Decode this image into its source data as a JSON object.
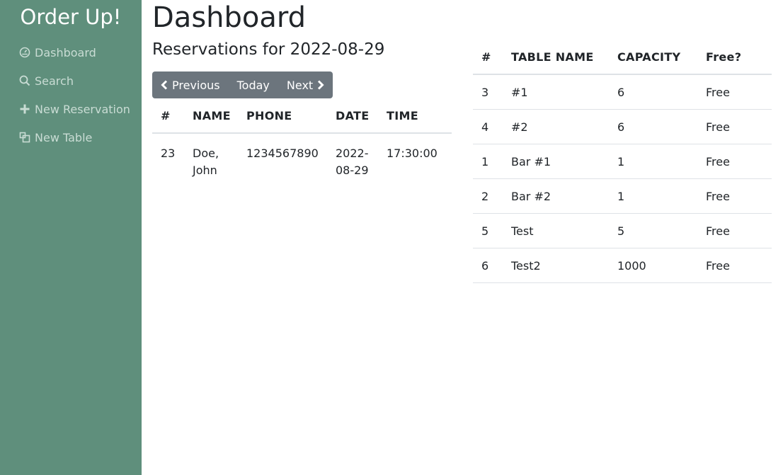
{
  "brand": "Order Up!",
  "nav": [
    {
      "label": "Dashboard",
      "icon": "dashboard-icon"
    },
    {
      "label": "Search",
      "icon": "search-icon"
    },
    {
      "label": "New Reservation",
      "icon": "plus-icon"
    },
    {
      "label": "New Table",
      "icon": "table-icon"
    }
  ],
  "page": {
    "title": "Dashboard",
    "subtitle": "Reservations for 2022-08-29"
  },
  "date_nav": {
    "previous": "Previous",
    "today": "Today",
    "next": "Next"
  },
  "reservations": {
    "headers": [
      "#",
      "NAME",
      "PHONE",
      "DATE",
      "TIME"
    ],
    "rows": [
      {
        "id": "23",
        "name": "Doe, John",
        "phone": "1234567890",
        "date": "2022-08-29",
        "time": "17:30:00"
      }
    ]
  },
  "tables": {
    "headers": [
      "#",
      "TABLE NAME",
      "CAPACITY",
      "Free?"
    ],
    "rows": [
      {
        "id": "3",
        "name": "#1",
        "capacity": "6",
        "status": "Free"
      },
      {
        "id": "4",
        "name": "#2",
        "capacity": "6",
        "status": "Free"
      },
      {
        "id": "1",
        "name": "Bar #1",
        "capacity": "1",
        "status": "Free"
      },
      {
        "id": "2",
        "name": "Bar #2",
        "capacity": "1",
        "status": "Free"
      },
      {
        "id": "5",
        "name": "Test",
        "capacity": "5",
        "status": "Free"
      },
      {
        "id": "6",
        "name": "Test2",
        "capacity": "1000",
        "status": "Free"
      }
    ]
  },
  "colors": {
    "sidebar": "#5f8f7c",
    "nav_text": "#c9dcd4",
    "button": "#6c757d"
  }
}
